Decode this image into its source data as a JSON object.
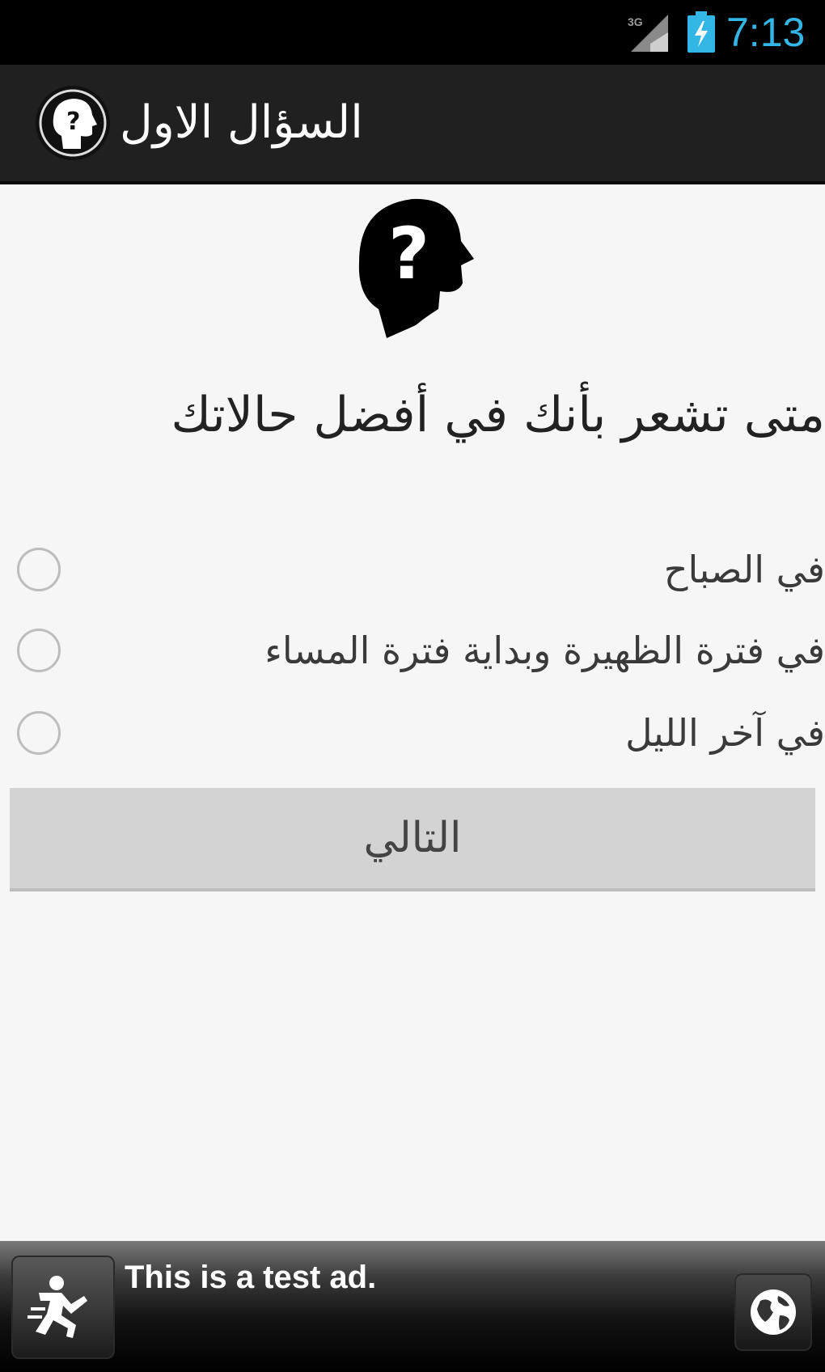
{
  "status_bar": {
    "time": "7:13",
    "network_label": "3G",
    "accent_color": "#33b5e5"
  },
  "action_bar": {
    "title": "السؤال الاول",
    "icon": "head-question-icon"
  },
  "question": {
    "image": "head-question-icon",
    "text": "متى تشعر بأنك في أفضل حالاتك"
  },
  "options": [
    {
      "label": "في الصباح",
      "selected": false
    },
    {
      "label": "في فترة الظهيرة وبداية فترة المساء",
      "selected": false
    },
    {
      "label": "في آخر الليل",
      "selected": false
    }
  ],
  "next_button": {
    "label": "التالي",
    "enabled": false
  },
  "ad": {
    "text": "This is a test ad.",
    "icon": "running-man-icon",
    "action_icon": "globe-icon"
  }
}
